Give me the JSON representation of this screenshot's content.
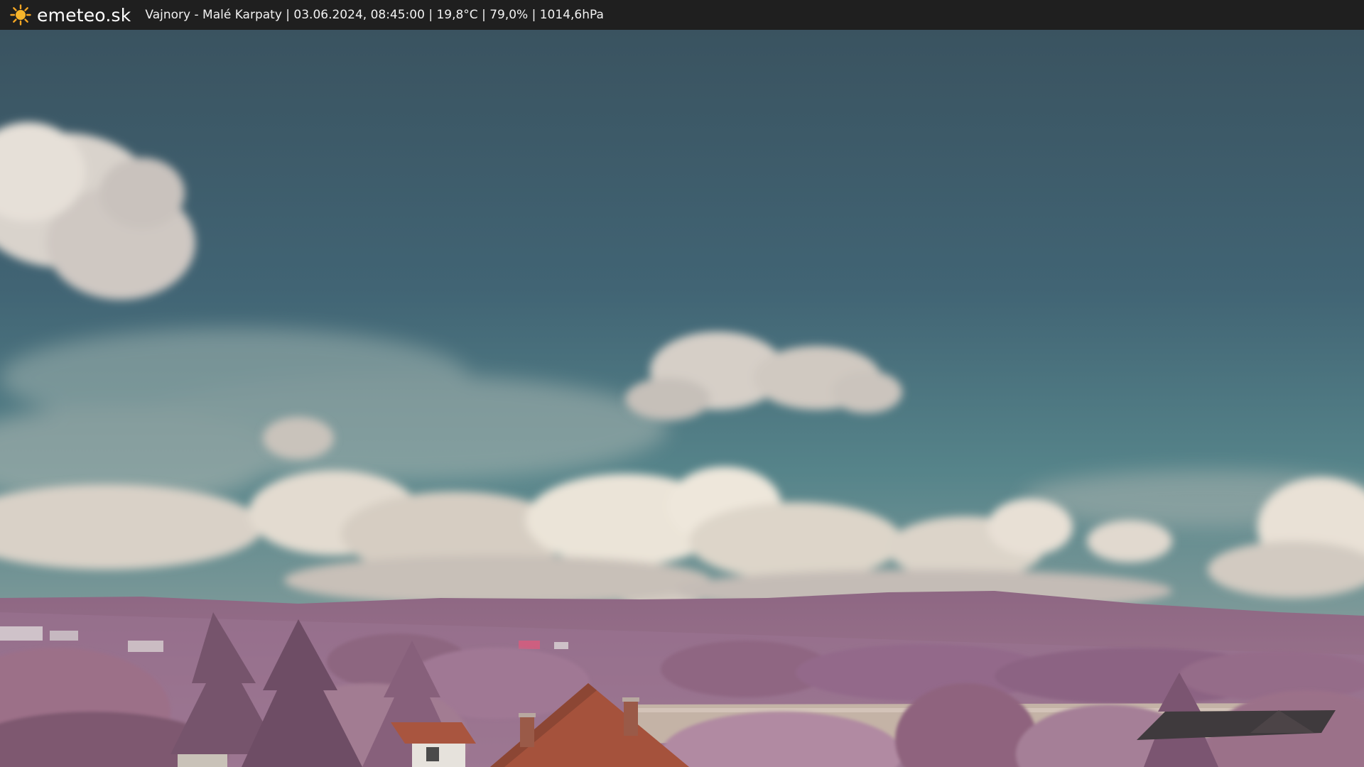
{
  "header": {
    "logo_icon": "sun-icon",
    "logo_text": "emeteo.sk",
    "caption": "Vajnory - Malé Karpaty | 03.06.2024, 08:45:00 | 19,8°C | 79,0% | 1014,6hPa"
  },
  "colors": {
    "bar_background": "#1f1f1f",
    "sky_top": "#3d5a66",
    "sky_bottom": "#5d8b8f",
    "foliage": "#9b6e8c",
    "roof": "#a8553f"
  }
}
